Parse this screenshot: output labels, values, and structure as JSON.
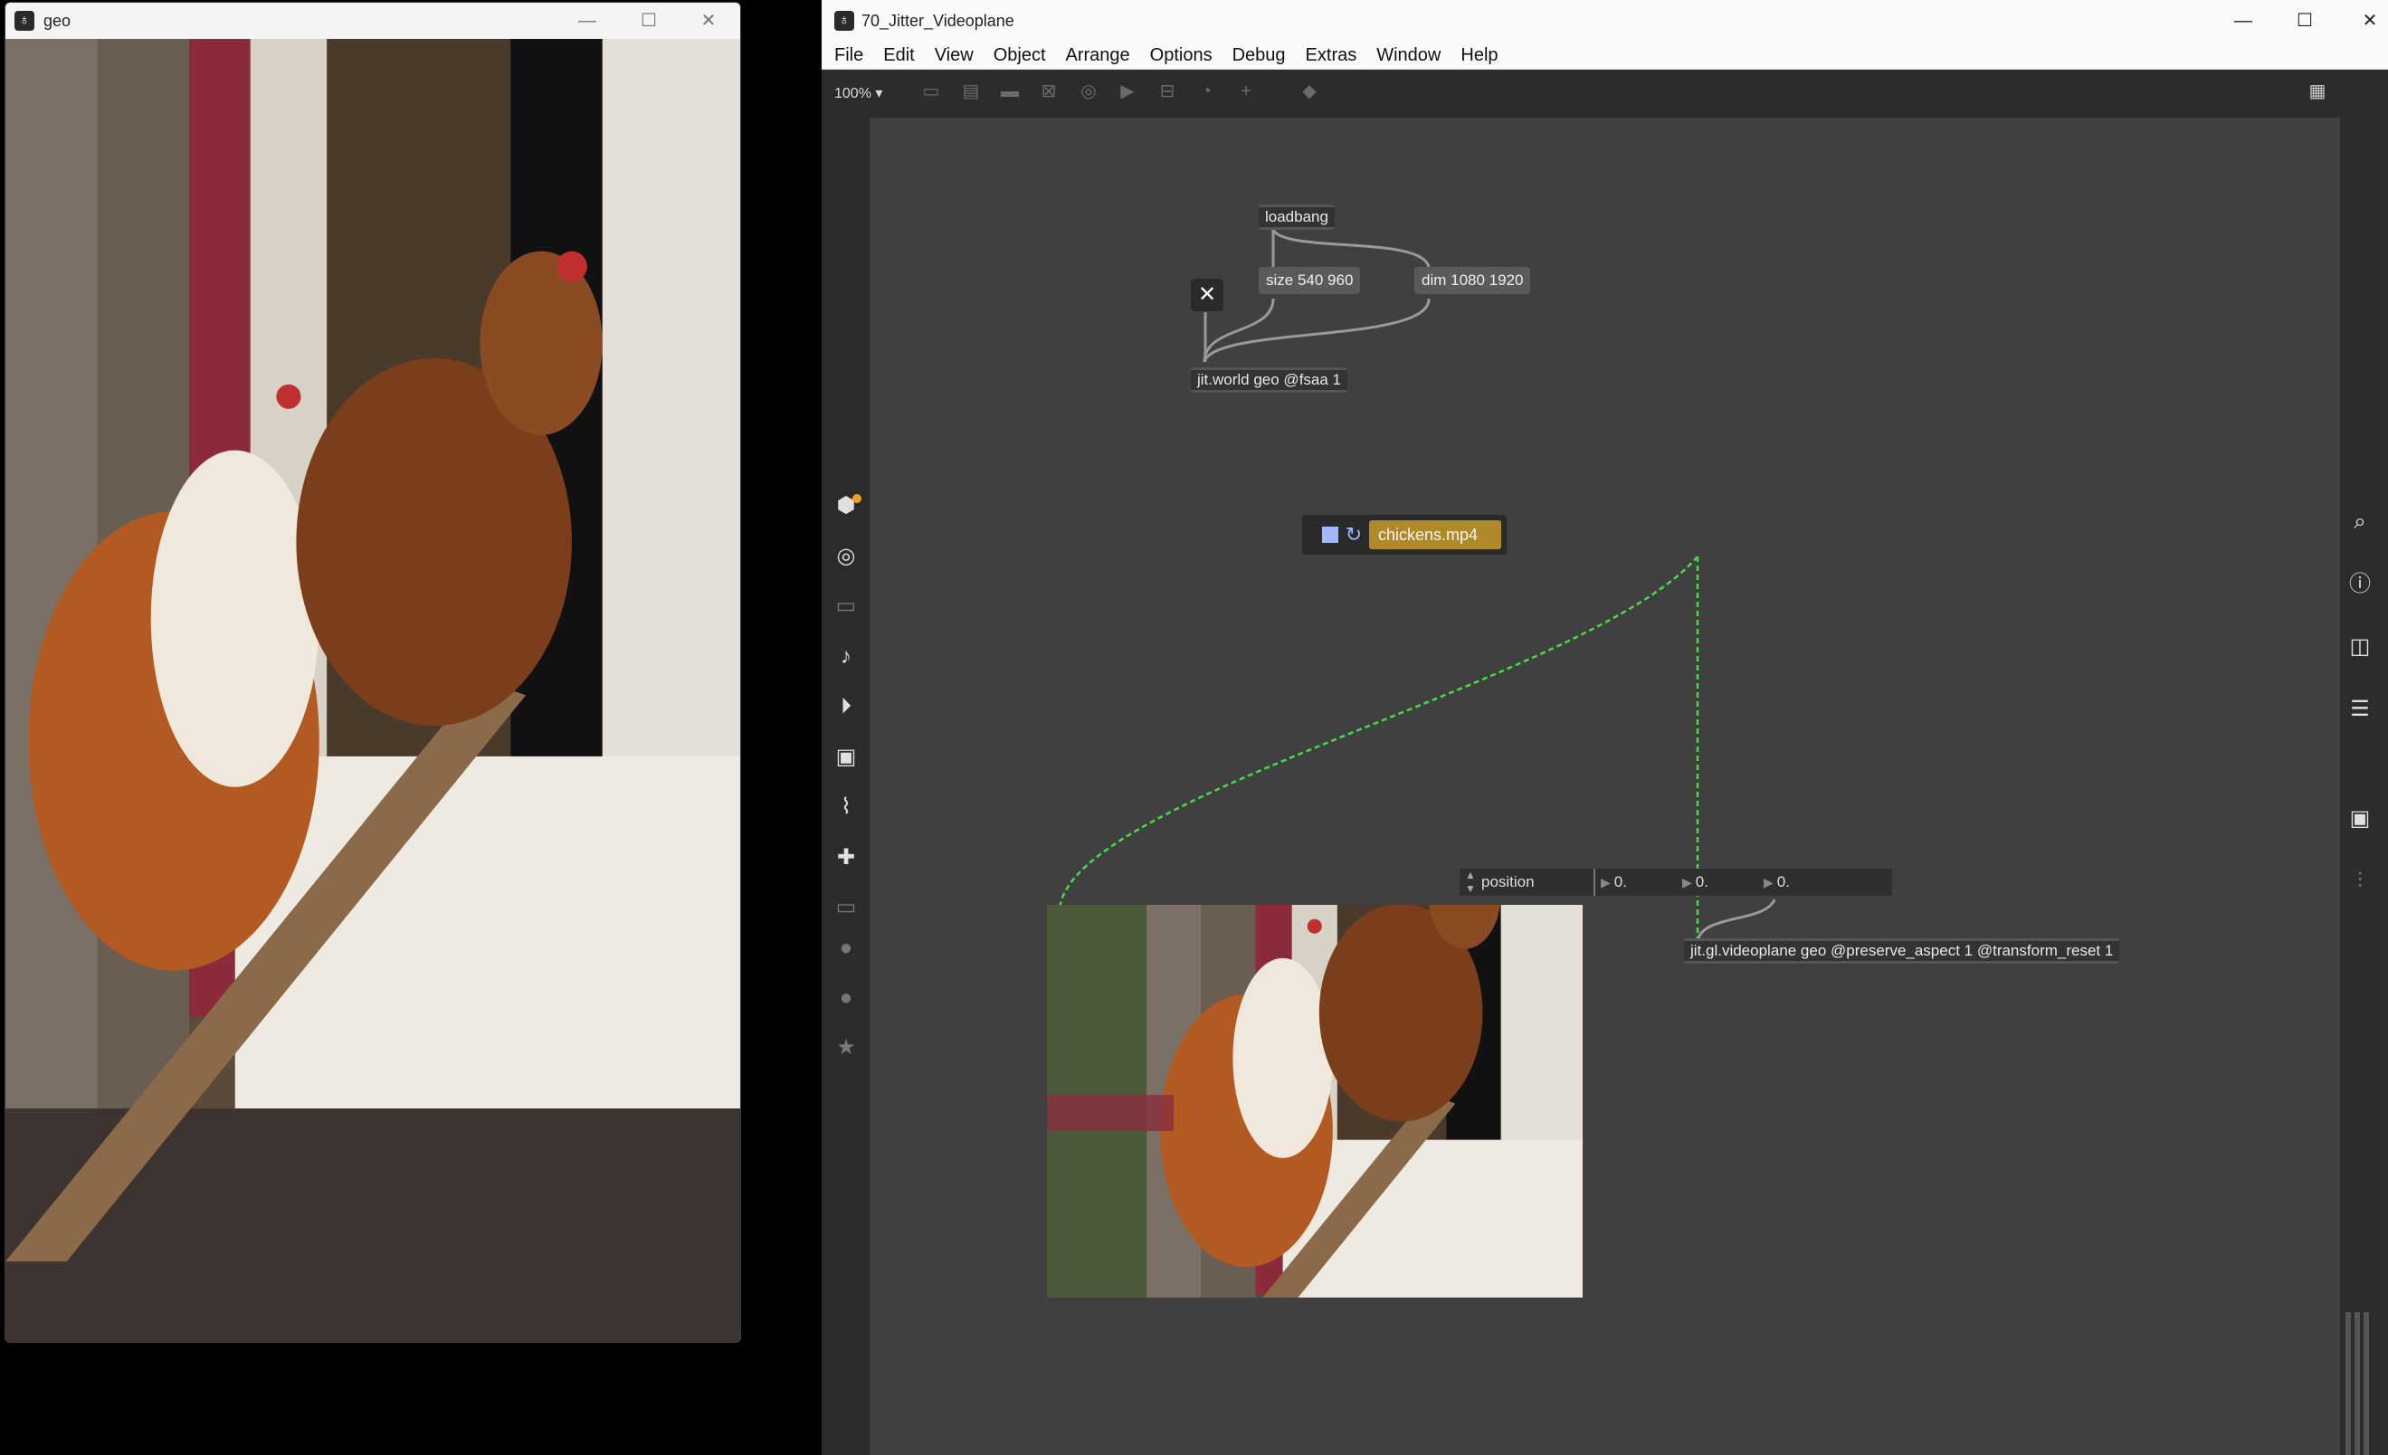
{
  "geo_window": {
    "title": "geo",
    "controls": {
      "minimize": "—",
      "maximize": "☐",
      "close": "✕"
    }
  },
  "max_window": {
    "title": "70_Jitter_Videoplane",
    "controls": {
      "minimize": "—",
      "maximize": "☐",
      "close": "✕"
    },
    "menu": [
      "File",
      "Edit",
      "View",
      "Object",
      "Arrange",
      "Options",
      "Debug",
      "Extras",
      "Window",
      "Help"
    ],
    "zoom": "100%",
    "toolbar_icons": [
      "object-box-icon",
      "message-box-icon",
      "comment-icon",
      "toggle-icon",
      "bang-icon",
      "button-icon",
      "slider-icon",
      "dial-icon",
      "add-icon",
      "paint-bucket-icon",
      "grid-icon"
    ],
    "left_sidebar_icons": [
      "package-icon",
      "target-icon",
      "browser-icon",
      "music-note-icon",
      "media-play-icon",
      "image-icon",
      "paperclip-icon",
      "plugin-icon",
      "device-icon",
      "vimeo-icon",
      "help-icon",
      "star-icon"
    ],
    "right_sidebar_icons": [
      "search-icon",
      "info-icon",
      "columns-icon",
      "list-icon",
      "snapshot-icon",
      "mixer-icon"
    ]
  },
  "patch": {
    "loadbang": "loadbang",
    "msg_size": "size 540 960",
    "msg_dim": "dim 1080 1920",
    "close_button": "✕",
    "jit_world": "jit.world geo @fsaa 1",
    "movie_file": "chickens.mp4",
    "position_label": "position",
    "position_values": [
      "0.",
      "0.",
      "0."
    ],
    "videoplane": "jit.gl.videoplane geo @preserve_aspect 1 @transform_reset 1"
  },
  "colors": {
    "canvas": "#404040",
    "patch_cord": "#9a9a9a",
    "video_cord": "#44dd44",
    "movie_box": "#b08a2a"
  }
}
